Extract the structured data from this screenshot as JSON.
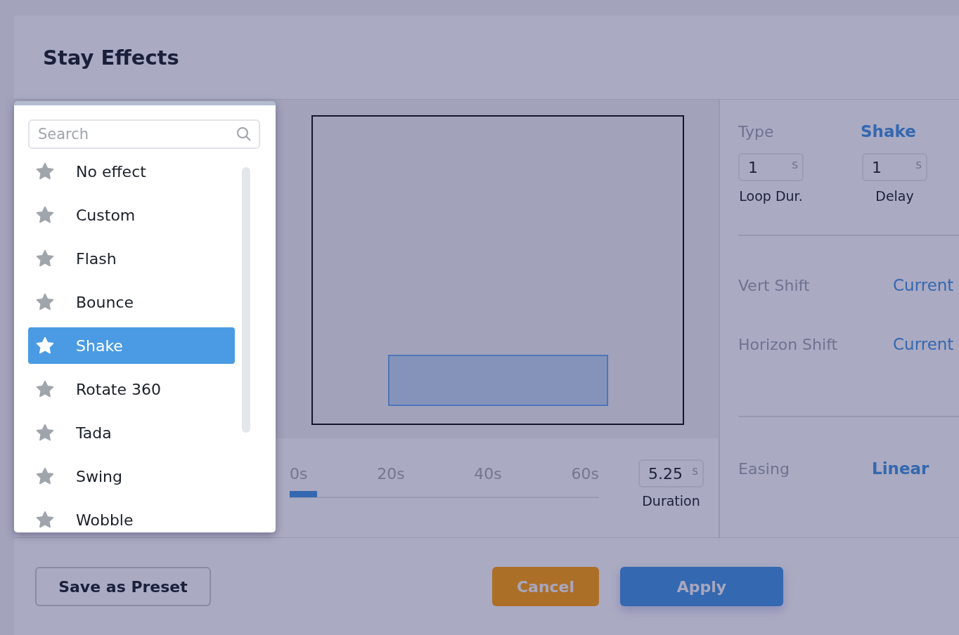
{
  "dialog": {
    "title": "Stay Effects"
  },
  "effect_list": {
    "search": {
      "placeholder": "Search"
    },
    "items": [
      {
        "label": "No effect",
        "selected": false
      },
      {
        "label": "Custom",
        "selected": false
      },
      {
        "label": "Flash",
        "selected": false
      },
      {
        "label": "Bounce",
        "selected": false
      },
      {
        "label": "Shake",
        "selected": true
      },
      {
        "label": "Rotate 360",
        "selected": false
      },
      {
        "label": "Tada",
        "selected": false
      },
      {
        "label": "Swing",
        "selected": false
      },
      {
        "label": "Wobble",
        "selected": false
      }
    ]
  },
  "timeline": {
    "ticks": [
      "0s",
      "20s",
      "40s",
      "60s"
    ],
    "level": 0.0875,
    "duration": {
      "value": "5.25",
      "unit": "s",
      "label": "Duration"
    }
  },
  "settings": {
    "type": {
      "label": "Type",
      "value": "Shake"
    },
    "fields": [
      {
        "value": "1",
        "unit": "s",
        "label": "Loop Dur."
      },
      {
        "value": "1",
        "unit": "s",
        "label": "Delay"
      }
    ],
    "shifts": [
      {
        "label": "Vert Shift",
        "value": "Current"
      },
      {
        "label": "Horizon Shift",
        "value": "Current"
      }
    ],
    "easing": {
      "label": "Easing",
      "value": "Linear"
    }
  },
  "footer": {
    "save": "Save as Preset",
    "cancel": "Cancel",
    "apply": "Apply"
  }
}
